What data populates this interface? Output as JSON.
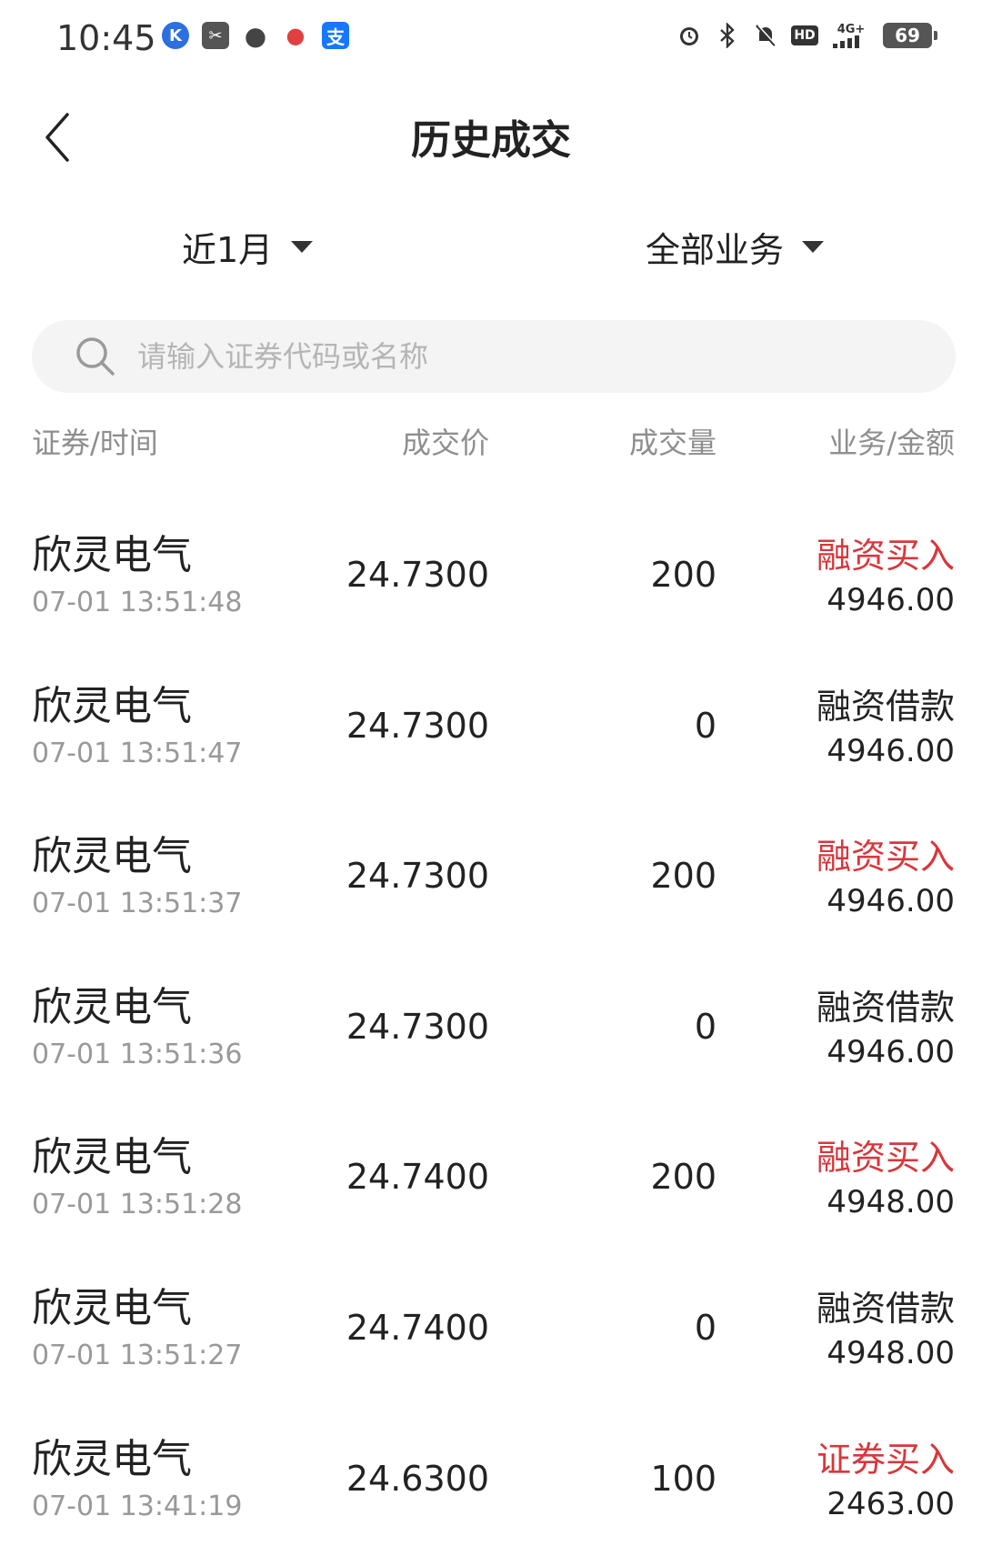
{
  "status_bar": {
    "time": "10:45",
    "battery": "69",
    "network": "4G+",
    "hd_label": "HD",
    "app_icons": [
      "k-app-icon",
      "scissors-app-icon",
      "message-icon",
      "map-pin-app-icon",
      "alipay-icon"
    ],
    "alipay_glyph": "支",
    "k_glyph": "K"
  },
  "header": {
    "title": "历史成交"
  },
  "filters": {
    "period": "近1月",
    "business": "全部业务"
  },
  "search": {
    "placeholder": "请输入证券代码或名称"
  },
  "columns": {
    "security_time": "证券/时间",
    "price": "成交价",
    "quantity": "成交量",
    "business_amount": "业务/金额"
  },
  "colors": {
    "accent_red": "#d8373b",
    "text": "#222222",
    "muted": "#999999"
  },
  "trades": [
    {
      "name": "欣灵电气",
      "time": "07-01 13:51:48",
      "price": "24.7300",
      "qty": "200",
      "business": "融资买入",
      "amount": "4946.00",
      "highlight": true
    },
    {
      "name": "欣灵电气",
      "time": "07-01 13:51:47",
      "price": "24.7300",
      "qty": "0",
      "business": "融资借款",
      "amount": "4946.00",
      "highlight": false
    },
    {
      "name": "欣灵电气",
      "time": "07-01 13:51:37",
      "price": "24.7300",
      "qty": "200",
      "business": "融资买入",
      "amount": "4946.00",
      "highlight": true
    },
    {
      "name": "欣灵电气",
      "time": "07-01 13:51:36",
      "price": "24.7300",
      "qty": "0",
      "business": "融资借款",
      "amount": "4946.00",
      "highlight": false
    },
    {
      "name": "欣灵电气",
      "time": "07-01 13:51:28",
      "price": "24.7400",
      "qty": "200",
      "business": "融资买入",
      "amount": "4948.00",
      "highlight": true
    },
    {
      "name": "欣灵电气",
      "time": "07-01 13:51:27",
      "price": "24.7400",
      "qty": "0",
      "business": "融资借款",
      "amount": "4948.00",
      "highlight": false
    },
    {
      "name": "欣灵电气",
      "time": "07-01 13:41:19",
      "price": "24.6300",
      "qty": "100",
      "business": "证券买入",
      "amount": "2463.00",
      "highlight": true
    }
  ]
}
